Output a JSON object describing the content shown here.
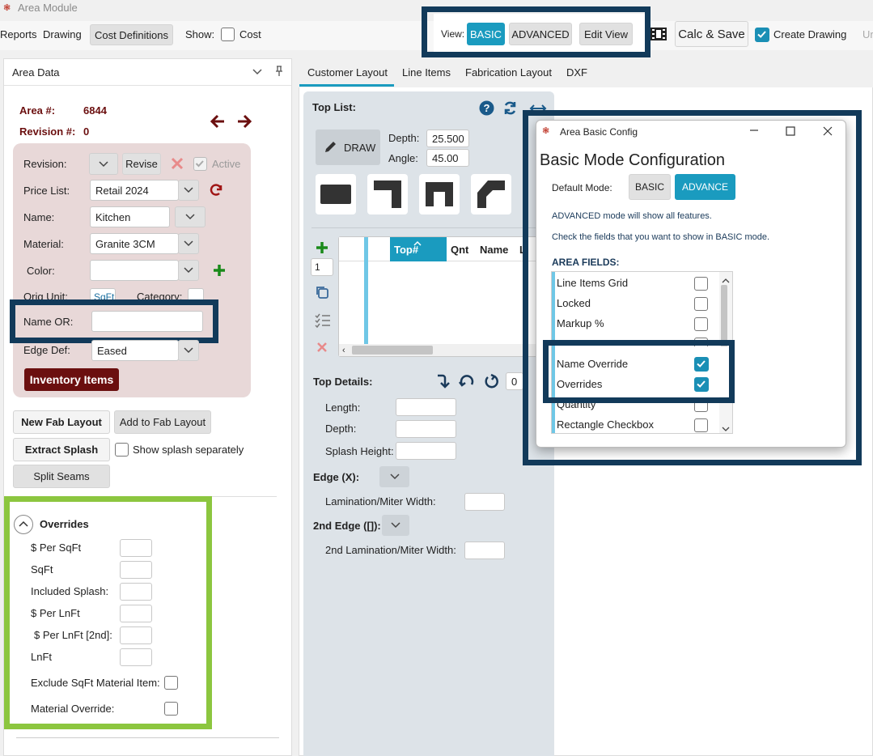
{
  "app": {
    "title": "Area Module"
  },
  "menubar": {
    "reports": "Reports",
    "drawing": "Drawing",
    "cost_definitions": "Cost Definitions",
    "show_label": "Show:",
    "cost_label": "Cost"
  },
  "toolbar": {
    "view_label": "View:",
    "basic": "BASIC",
    "advanced": "ADVANCED",
    "edit_view": "Edit View",
    "calc_save": "Calc & Save",
    "create_drawing": "Create Drawing",
    "undo_partial": "Ur"
  },
  "area_panel": {
    "title": "Area Data",
    "area_label": "Area #:",
    "area_value": "6844",
    "revision_label": "Revision #:",
    "revision_value": "0",
    "fields": {
      "revision": "Revision:",
      "revise": "Revise",
      "active": "Active",
      "price_list": "Price List:",
      "price_list_value": "Retail 2024",
      "name": "Name:",
      "name_value": "Kitchen",
      "material": "Material:",
      "material_value": "Granite 3CM",
      "color": "Color:",
      "orig_unit": "Orig Unit:",
      "orig_unit_value": "SqFt",
      "category": "Category:",
      "name_or": "Name OR:",
      "edge_def": "Edge Def:",
      "edge_def_value": "Eased"
    },
    "inventory_items": "Inventory Items",
    "new_fab_layout": "New Fab Layout",
    "add_to_fab_layout": "Add to Fab Layout",
    "extract_splash": "Extract Splash",
    "show_splash_separately": "Show splash separately",
    "split_seams": "Split Seams",
    "overrides": {
      "title": "Overrides",
      "per_sqft": "$ Per SqFt",
      "sqft": "SqFt",
      "included_splash": "Included Splash:",
      "per_lnft": "$ Per LnFt",
      "per_lnft_2nd": "$ Per LnFt [2nd]:",
      "lnft": "LnFt",
      "exclude_sqft": "Exclude SqFt Material Item:",
      "material_override": "Material Override:"
    }
  },
  "tabs": [
    "Customer Layout",
    "Line Items",
    "Fabrication Layout",
    "DXF"
  ],
  "top_list": {
    "title": "Top List:",
    "draw": "DRAW",
    "depth_label": "Depth:",
    "depth_value": "25.500",
    "angle_label": "Angle:",
    "angle_value": "45.00",
    "qty_value": "1",
    "grid_cols": [
      "Top#",
      "Qnt",
      "Name",
      "L"
    ]
  },
  "top_details": {
    "title": "Top Details:",
    "rotate_value": "0",
    "length": "Length:",
    "depth": "Depth:",
    "splash_height": "Splash Height:",
    "edge_x": "Edge (X):",
    "lamination": "Lamination/Miter Width:",
    "edge_2nd": "2nd Edge ([]):",
    "lamination_2nd": "2nd Lamination/Miter Width:"
  },
  "dialog": {
    "title": "Area Basic Config",
    "heading": "Basic Mode Configuration",
    "default_mode": "Default Mode:",
    "basic": "BASIC",
    "advance": "ADVANCE",
    "info1": "ADVANCED mode will show all features.",
    "info2": "Check the fields that you want to show in BASIC mode.",
    "area_fields": "AREA FIELDS:",
    "items": [
      {
        "label": "Line Items Grid",
        "checked": false
      },
      {
        "label": "Locked",
        "checked": false
      },
      {
        "label": "Markup %",
        "checked": false
      },
      {
        "label": "",
        "checked": false
      },
      {
        "label": "Name Override",
        "checked": true
      },
      {
        "label": "Overrides",
        "checked": true
      },
      {
        "label": "Quantity",
        "checked": false
      },
      {
        "label": "Rectangle Checkbox",
        "checked": false
      }
    ]
  },
  "colors": {
    "accent": "#1a9bbf",
    "maroon": "#6b0f0f",
    "highlight_navy": "#123a5a",
    "highlight_green": "#8cc63f"
  }
}
